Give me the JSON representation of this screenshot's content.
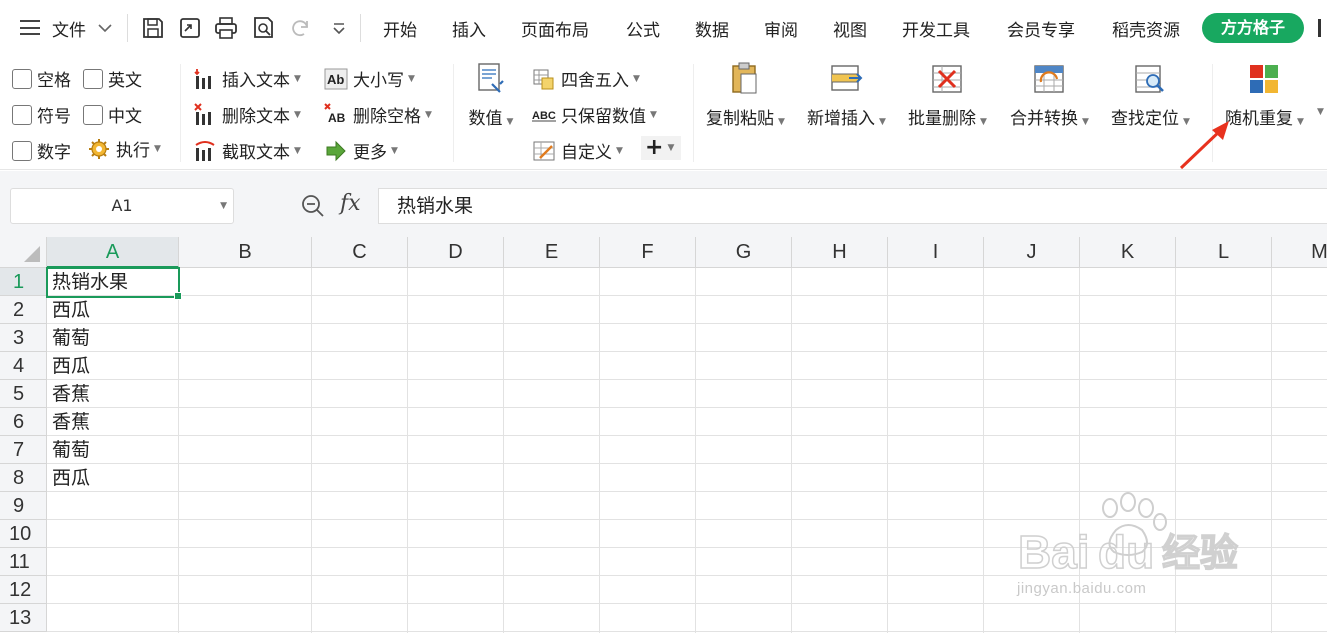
{
  "menubar": {
    "file_label": "文件",
    "tabs": [
      "开始",
      "插入",
      "页面布局",
      "公式",
      "数据",
      "审阅",
      "视图",
      "开发工具",
      "会员专享",
      "稻壳资源"
    ],
    "highlight_tab": "方方格子"
  },
  "ribbon": {
    "checkboxes": [
      "空格",
      "英文",
      "符号",
      "中文",
      "数字"
    ],
    "execute_label": "执行",
    "text_group": [
      "插入文本",
      "删除文本",
      "截取文本"
    ],
    "case_group": [
      "大小写",
      "删除空格",
      "更多"
    ],
    "number_label": "数值",
    "number_group": [
      "四舍五入",
      "只保留数值",
      "自定义"
    ],
    "big_buttons": [
      "复制粘贴",
      "新增插入",
      "批量删除",
      "合并转换",
      "查找定位",
      "随机重复"
    ]
  },
  "formula_bar": {
    "name_box": "A1",
    "fx_label": "fx",
    "content": "热销水果"
  },
  "sheet": {
    "columns": [
      "A",
      "B",
      "C",
      "D",
      "E",
      "F",
      "G",
      "H",
      "I",
      "J",
      "K",
      "L",
      "M"
    ],
    "rows": [
      "1",
      "2",
      "3",
      "4",
      "5",
      "6",
      "7",
      "8",
      "9",
      "10",
      "11",
      "12",
      "13"
    ],
    "cells_a": [
      "热销水果",
      "西瓜",
      "葡萄",
      "西瓜",
      "香蕉",
      "香蕉",
      "葡萄",
      "西瓜"
    ]
  },
  "watermark": {
    "logo": "Baidu经验",
    "url": "jingyan.baidu.com"
  },
  "colors": {
    "accent_green": "#18a860",
    "selection_green": "#1a9a5a",
    "annotation_red": "#e8321e"
  }
}
